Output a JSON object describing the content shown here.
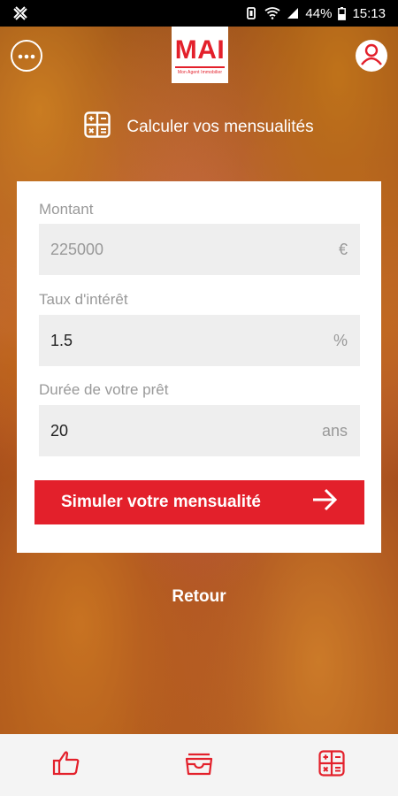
{
  "status_bar": {
    "battery": "44%",
    "time": "15:13"
  },
  "header": {
    "logo_text": "MAI",
    "logo_subtext": "Mon Agent Immobilier",
    "menu_icon": "more-horizontal-icon",
    "user_icon": "user-icon"
  },
  "section": {
    "icon": "calculator-icon",
    "title": "Calculer vos mensualités"
  },
  "form": {
    "amount": {
      "label": "Montant",
      "placeholder": "225000",
      "value": "",
      "unit": "€"
    },
    "rate": {
      "label": "Taux d'intérêt",
      "value": "1.5",
      "unit": "%"
    },
    "duration": {
      "label": "Durée de votre prêt",
      "value": "20",
      "unit": "ans"
    },
    "submit_label": "Simuler votre mensualité"
  },
  "back_label": "Retour",
  "bottom_nav": {
    "items": [
      {
        "icon": "thumbs-up-icon"
      },
      {
        "icon": "inbox-tray-icon"
      },
      {
        "icon": "calculator-icon"
      }
    ]
  },
  "colors": {
    "brand_red": "#e3202b",
    "field_bg": "#eeeeee",
    "nav_bg": "#f4f4f4"
  }
}
